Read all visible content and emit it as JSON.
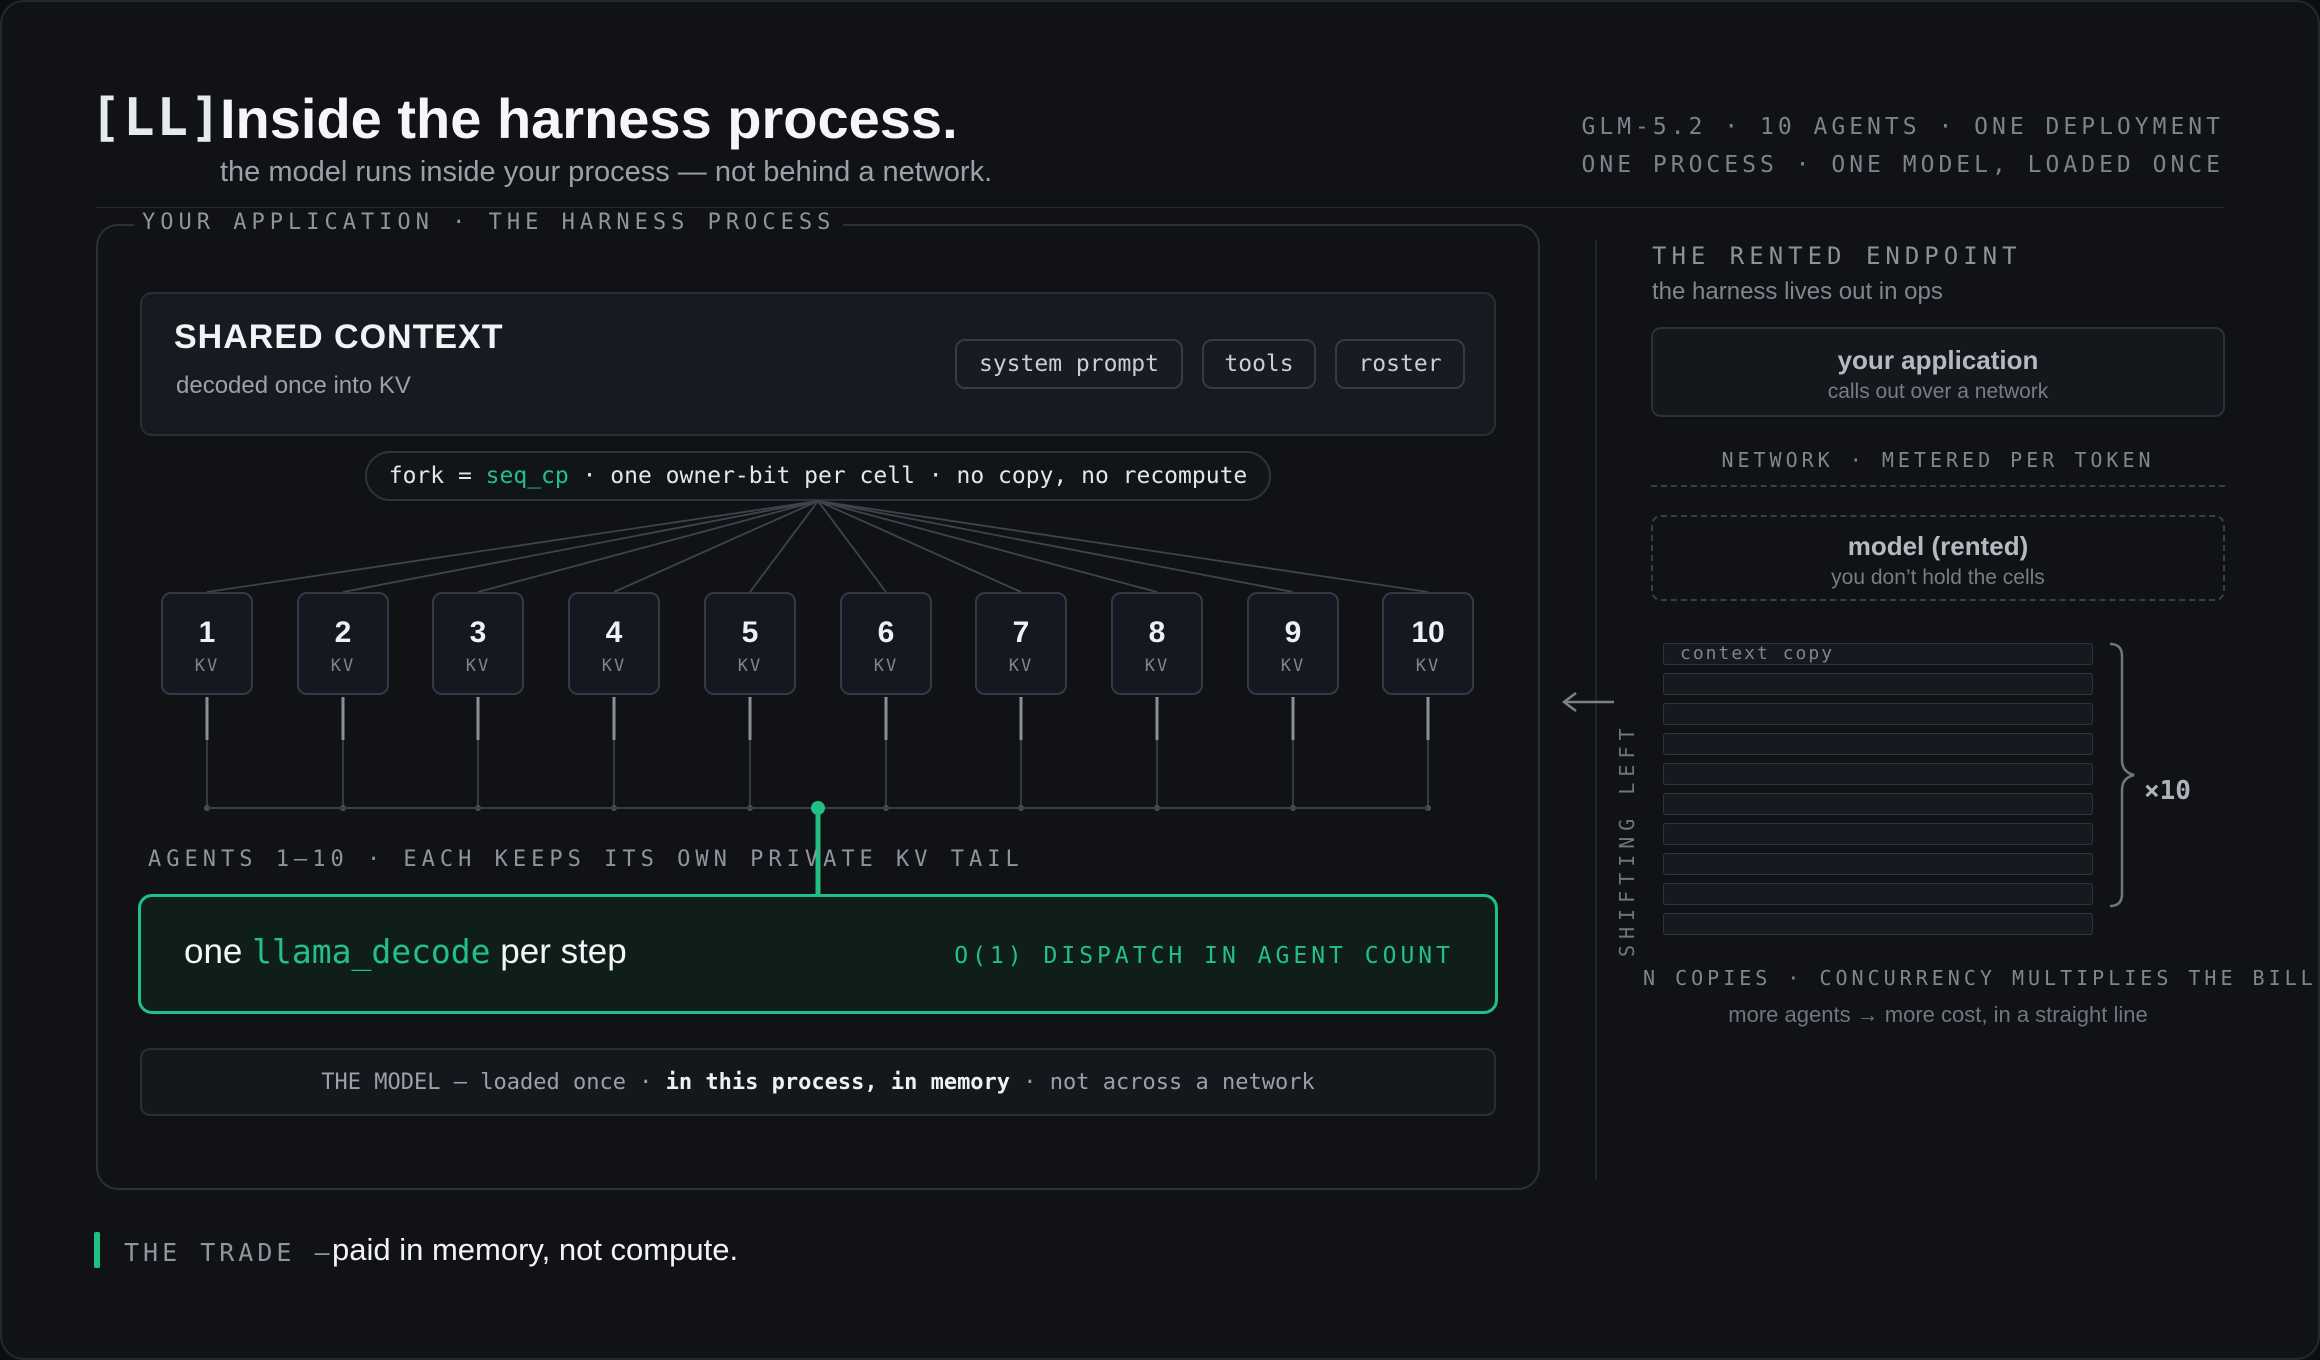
{
  "header": {
    "logo": "[LL]",
    "title": "Inside the harness process.",
    "subtitle": "the model runs inside your process — not behind a network.",
    "meta_line1": "GLM-5.2 · 10 AGENTS · ONE DEPLOYMENT",
    "meta_line2": "ONE PROCESS · ONE MODEL, LOADED ONCE"
  },
  "process": {
    "label": "YOUR APPLICATION · THE HARNESS PROCESS",
    "shared_title": "SHARED CONTEXT",
    "shared_sub": "decoded once into KV",
    "chips": [
      "system prompt",
      "tools",
      "roster"
    ],
    "fork": {
      "prefix": "fork = ",
      "fn": "seq_cp",
      "suffix": " · one owner-bit per cell · no copy, no recompute"
    },
    "agents": [
      {
        "num": "1",
        "label": "KV"
      },
      {
        "num": "2",
        "label": "KV"
      },
      {
        "num": "3",
        "label": "KV"
      },
      {
        "num": "4",
        "label": "KV"
      },
      {
        "num": "5",
        "label": "KV"
      },
      {
        "num": "6",
        "label": "KV"
      },
      {
        "num": "7",
        "label": "KV"
      },
      {
        "num": "8",
        "label": "KV"
      },
      {
        "num": "9",
        "label": "KV"
      },
      {
        "num": "10",
        "label": "KV"
      }
    ],
    "agents_label": "AGENTS 1–10 · EACH KEEPS ITS OWN PRIVATE KV TAIL",
    "decode": {
      "pre": "one ",
      "fn": "llama_decode",
      "post": " per step",
      "right": "O(1) DISPATCH IN AGENT COUNT"
    },
    "model_bar": {
      "a": "THE MODEL — loaded once · ",
      "b": "in this process, in memory",
      "c": " · not across a network"
    }
  },
  "trade": {
    "label": "THE TRADE —",
    "text": "paid in memory, not compute."
  },
  "right": {
    "shifting": "SHIFTING LEFT",
    "title": "THE RENTED ENDPOINT",
    "sub": "the harness lives out in ops",
    "app_title": "your application",
    "app_sub": "calls out over a network",
    "network": "NETWORK · METERED PER TOKEN",
    "rented_title": "model (rented)",
    "rented_sub": "you don’t hold the cells",
    "copy_label": "context copy",
    "copy_count": 10,
    "times": "×10",
    "ncopies": "N COPIES · CONCURRENCY MULTIPLIES THE BILL",
    "ncopies_sub": "more agents → more cost, in a straight line"
  },
  "colors": {
    "accent": "#22c088",
    "background": "#101216"
  }
}
